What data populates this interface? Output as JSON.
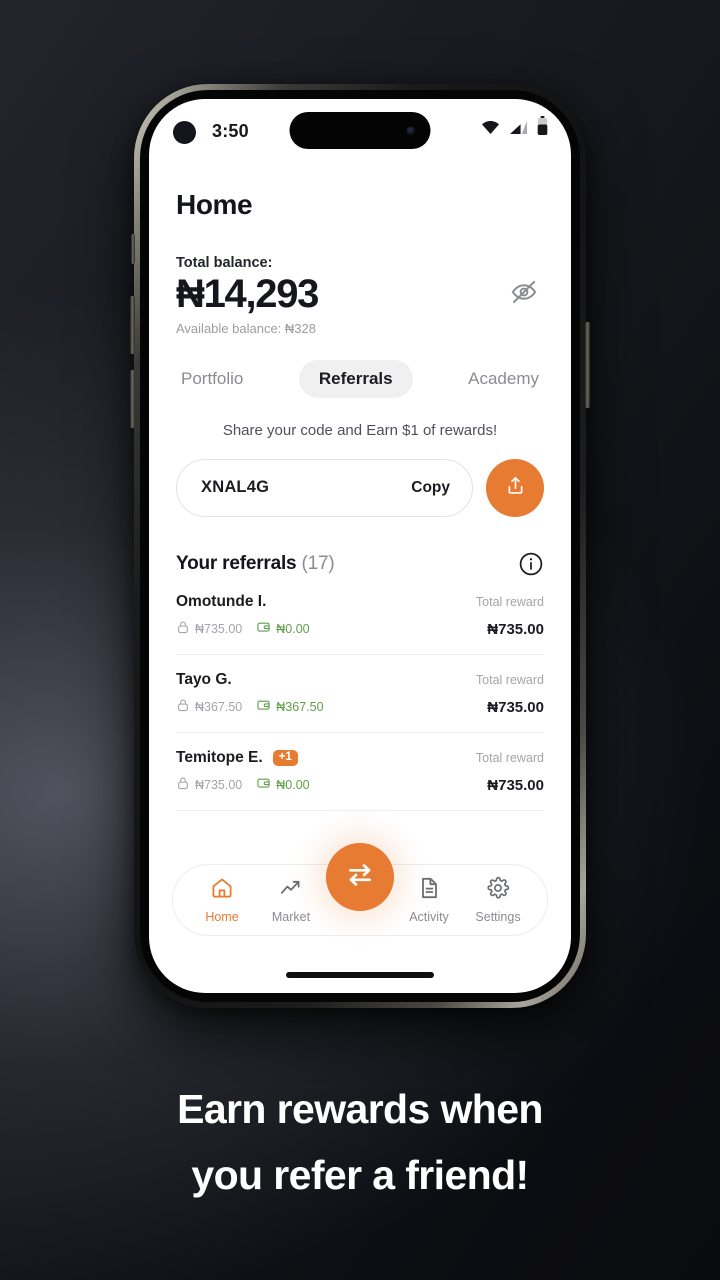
{
  "statusbar": {
    "time": "3:50",
    "wifi_icon": "wifi-icon",
    "cellular_icon": "cellular-signal-icon",
    "battery_icon": "battery-icon"
  },
  "header": {
    "title": "Home"
  },
  "balance": {
    "label": "Total balance:",
    "amount": "₦14,293",
    "available_prefix": "Available balance:",
    "available_amount": "₦328",
    "hide_icon": "eye-off-icon"
  },
  "tabs": [
    {
      "label": "Portfolio",
      "active": false
    },
    {
      "label": "Referrals",
      "active": true
    },
    {
      "label": "Academy",
      "active": false
    }
  ],
  "referral": {
    "promo": "Share your code and Earn $1 of rewards!",
    "code": "XNAL4G",
    "copy_label": "Copy",
    "share_icon": "share-upload-icon"
  },
  "referrals_section": {
    "title": "Your referrals",
    "count": "(17)",
    "info_icon": "info-circle-icon",
    "total_reward_label": "Total reward",
    "locked_icon": "lock-icon",
    "available_icon": "wallet-icon",
    "rows": [
      {
        "name": "Omotunde I.",
        "badge": "",
        "locked": "₦735.00",
        "available": "₦0.00",
        "total": "₦735.00"
      },
      {
        "name": "Tayo G.",
        "badge": "",
        "locked": "₦367.50",
        "available": "₦367.50",
        "total": "₦735.00"
      },
      {
        "name": "Temitope E.",
        "badge": "+1",
        "locked": "₦735.00",
        "available": "₦0.00",
        "total": "₦735.00"
      }
    ]
  },
  "bottom_nav": {
    "items": [
      {
        "label": "Home",
        "icon": "home-icon",
        "active": true
      },
      {
        "label": "Market",
        "icon": "trending-up-icon",
        "active": false
      },
      {
        "label": "Activity",
        "icon": "document-icon",
        "active": false
      },
      {
        "label": "Settings",
        "icon": "gear-icon",
        "active": false
      }
    ],
    "fab_icon": "swap-arrows-icon"
  },
  "caption": {
    "line1": "Earn rewards when",
    "line2": "you refer a friend!"
  },
  "colors": {
    "accent": "#e87b32",
    "text": "#1b1c21",
    "muted": "#8b8c92",
    "green": "#5f9e48"
  }
}
